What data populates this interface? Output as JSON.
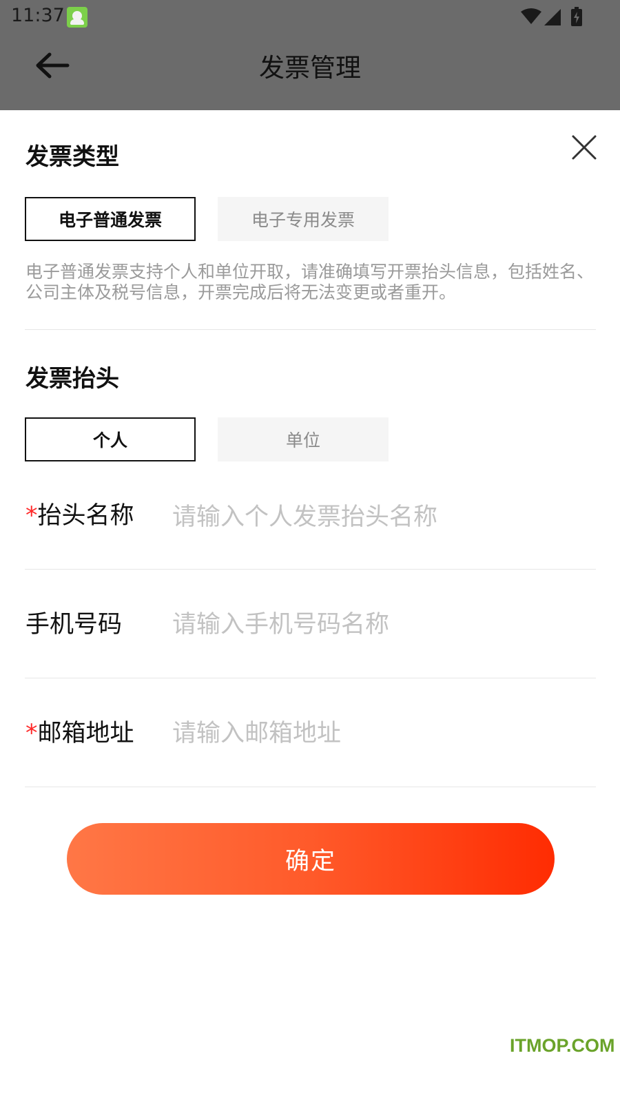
{
  "status_bar": {
    "time": "11:37"
  },
  "header": {
    "title": "发票管理"
  },
  "invoice_type": {
    "section_title": "发票类型",
    "options": [
      {
        "label": "电子普通发票",
        "selected": true
      },
      {
        "label": "电子专用发票",
        "selected": false
      }
    ],
    "description": "电子普通发票支持个人和单位开取，请准确填写开票抬头信息，包括姓名、公司主体及税号信息，开票完成后将无法变更或者重开。"
  },
  "invoice_header": {
    "section_title": "发票抬头",
    "options": [
      {
        "label": "个人",
        "selected": true
      },
      {
        "label": "单位",
        "selected": false
      }
    ]
  },
  "form": {
    "fields": [
      {
        "label": "抬头名称",
        "required": true,
        "placeholder": "请输入个人发票抬头名称",
        "value": ""
      },
      {
        "label": "手机号码",
        "required": false,
        "placeholder": "请输入手机号码名称",
        "value": ""
      },
      {
        "label": "邮箱地址",
        "required": true,
        "placeholder": "请输入邮箱地址",
        "value": ""
      }
    ],
    "required_mark": "*"
  },
  "actions": {
    "confirm_label": "确定"
  },
  "watermark": "ITMOP.COM",
  "colors": {
    "accent_start": "#ff7746",
    "accent_end": "#ff2c02",
    "required": "#ff2a2a",
    "overlay": "#6b6b6b"
  }
}
